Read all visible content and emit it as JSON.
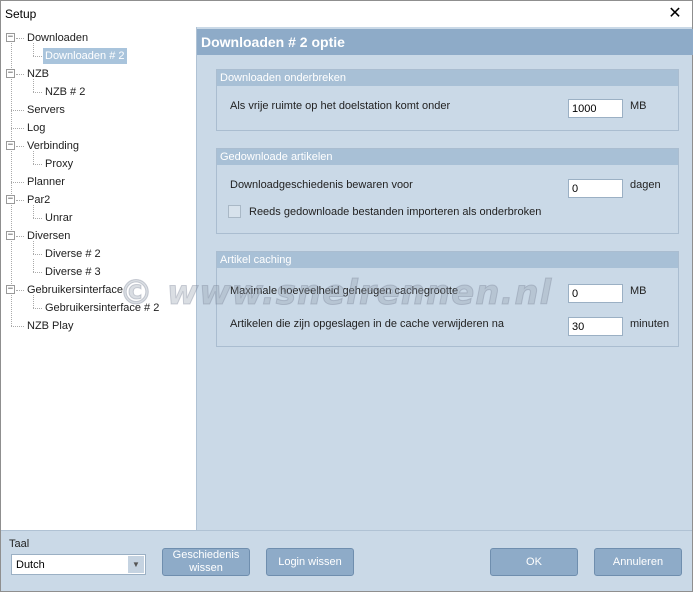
{
  "window": {
    "title": "Setup",
    "close_glyph": "✕"
  },
  "tree": {
    "items": [
      {
        "label": "Downloaden",
        "level": 0,
        "expander": "−"
      },
      {
        "label": "Downloaden # 2",
        "level": 1,
        "selected": true
      },
      {
        "label": "NZB",
        "level": 0,
        "expander": "−"
      },
      {
        "label": "NZB # 2",
        "level": 1
      },
      {
        "label": "Servers",
        "level": 0
      },
      {
        "label": "Log",
        "level": 0
      },
      {
        "label": "Verbinding",
        "level": 0,
        "expander": "−"
      },
      {
        "label": "Proxy",
        "level": 1
      },
      {
        "label": "Planner",
        "level": 0
      },
      {
        "label": "Par2",
        "level": 0,
        "expander": "−"
      },
      {
        "label": "Unrar",
        "level": 1
      },
      {
        "label": "Diversen",
        "level": 0,
        "expander": "−"
      },
      {
        "label": "Diverse # 2",
        "level": 1
      },
      {
        "label": "Diverse # 3",
        "level": 1
      },
      {
        "label": "Gebruikersinterface",
        "level": 0,
        "expander": "−"
      },
      {
        "label": "Gebruikersinterface # 2",
        "level": 1
      },
      {
        "label": "NZB Play",
        "level": 0
      }
    ]
  },
  "panel": {
    "title": "Downloaden # 2 optie",
    "groups": {
      "pause": {
        "title": "Downloaden onderbreken",
        "free_space_label": "Als vrije ruimte op het doelstation komt onder",
        "free_space_value": "1000",
        "free_space_unit": "MB"
      },
      "history": {
        "title": "Gedownloade artikelen",
        "keep_label": "Downloadgeschiedenis bewaren voor",
        "keep_value": "0",
        "keep_unit": "dagen",
        "import_label": "Reeds gedownloade bestanden importeren als onderbroken",
        "import_checked": false
      },
      "cache": {
        "title": "Artikel caching",
        "max_label": "Maximale hoeveelheid geheugen cachegrootte",
        "max_value": "0",
        "max_unit": "MB",
        "expire_label": "Artikelen die zijn opgeslagen in de cache verwijderen na",
        "expire_value": "30",
        "expire_unit": "minuten"
      }
    }
  },
  "bottom": {
    "language_label": "Taal",
    "language_value": "Dutch",
    "clear_history_line1": "Geschiedenis",
    "clear_history_line2": "wissen",
    "clear_login": "Login wissen",
    "ok": "OK",
    "cancel": "Annuleren"
  },
  "watermark": "© www.snelrennen.nl"
}
